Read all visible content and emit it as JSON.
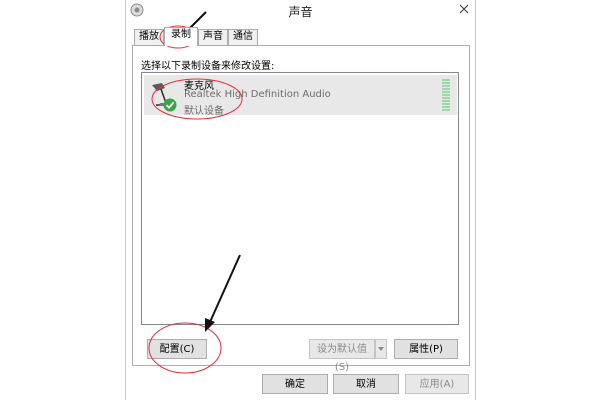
{
  "window": {
    "title": "声音"
  },
  "tabs": [
    {
      "label": "播放"
    },
    {
      "label": "录制"
    },
    {
      "label": "声音"
    },
    {
      "label": "通信"
    }
  ],
  "recording": {
    "instruction": "选择以下录制设备来修改设置:",
    "devices": [
      {
        "name": "麦克风",
        "driver": "Realtek High Definition Audio",
        "status": "默认设备",
        "icon": "microphone-icon",
        "status_icon": "check-icon"
      }
    ]
  },
  "buttons": {
    "configure": "配置(C)",
    "set_default": "设为默认值(S)",
    "properties": "属性(P)",
    "ok": "确定",
    "cancel": "取消",
    "apply": "应用(A)"
  },
  "colors": {
    "annotation": "#e0303a",
    "arrow": "#111111",
    "check": "#3aa447",
    "meter": "#9fd8a8"
  }
}
